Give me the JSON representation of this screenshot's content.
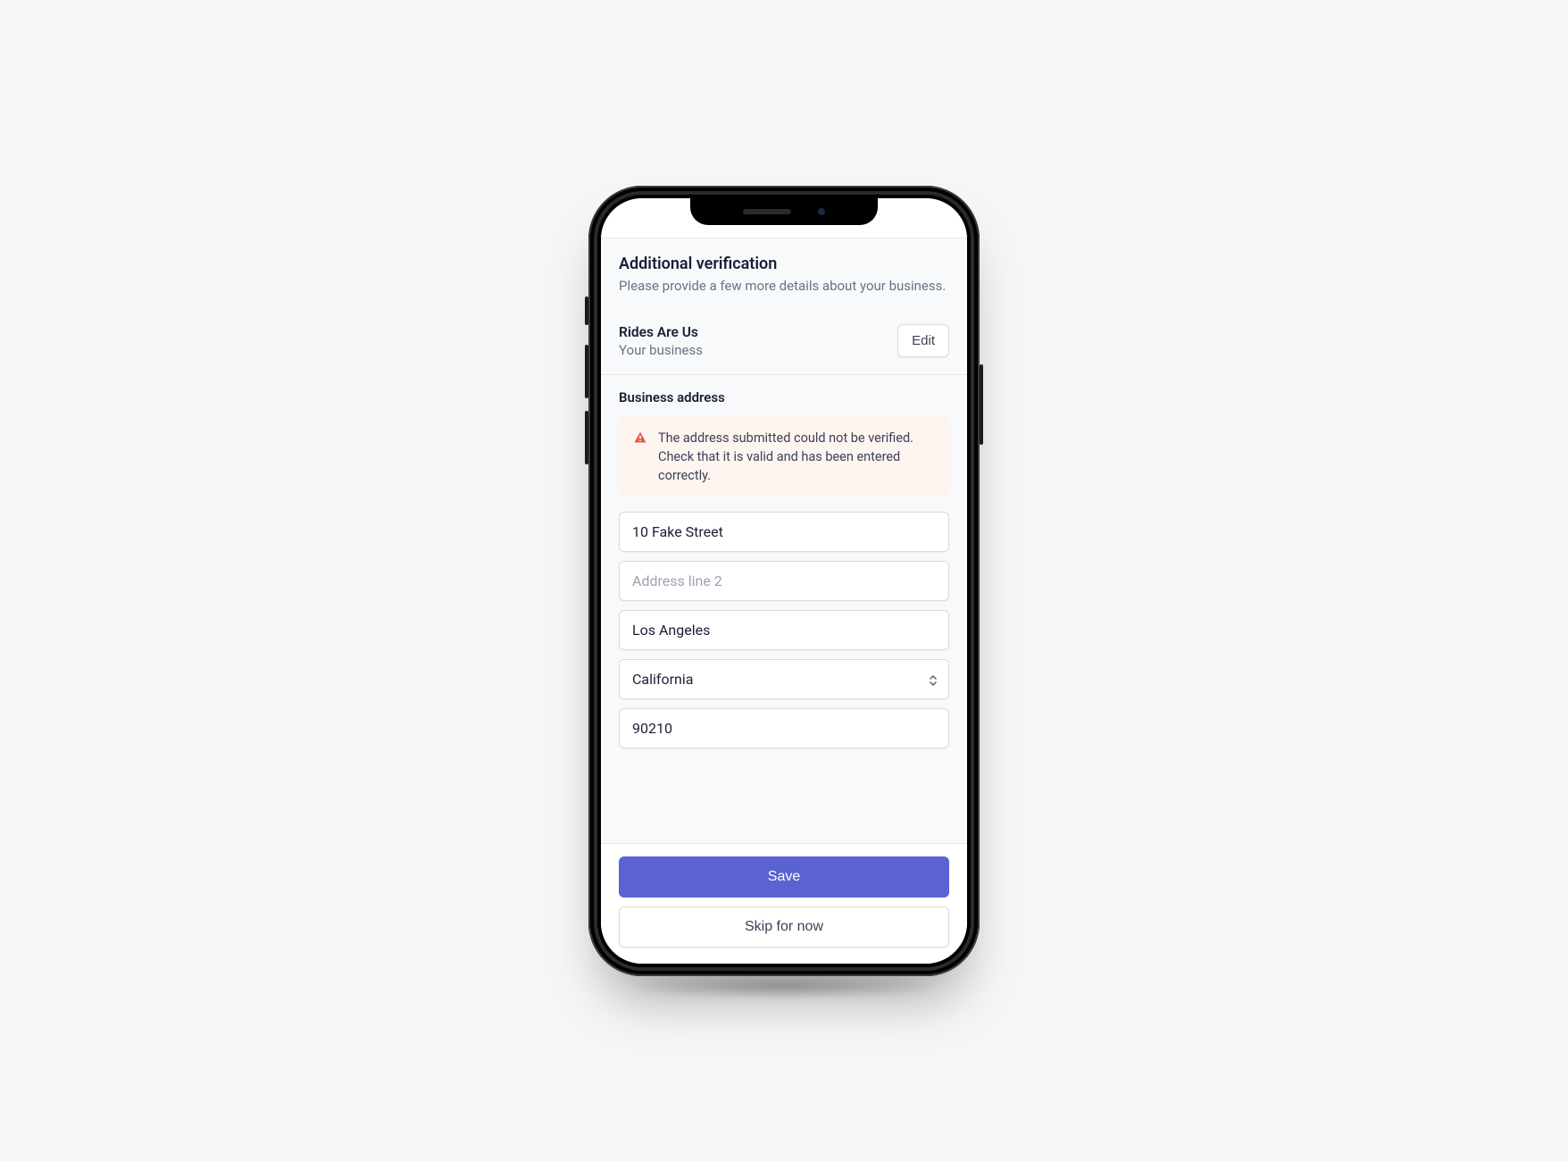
{
  "header": {
    "title": "Additional verification",
    "subtitle": "Please provide a few more details about your business."
  },
  "business": {
    "name": "Rides Are Us",
    "type_label": "Your business",
    "edit_label": "Edit"
  },
  "address": {
    "section_label": "Business address",
    "error_message": "The address submitted could not be verified. Check that it is valid and has been entered correctly.",
    "line1_value": "10 Fake Street",
    "line2_value": "",
    "line2_placeholder": "Address line 2",
    "city_value": "Los Angeles",
    "state_value": "California",
    "zip_value": "90210"
  },
  "footer": {
    "primary_label": "Save",
    "secondary_label": "Skip for now"
  }
}
